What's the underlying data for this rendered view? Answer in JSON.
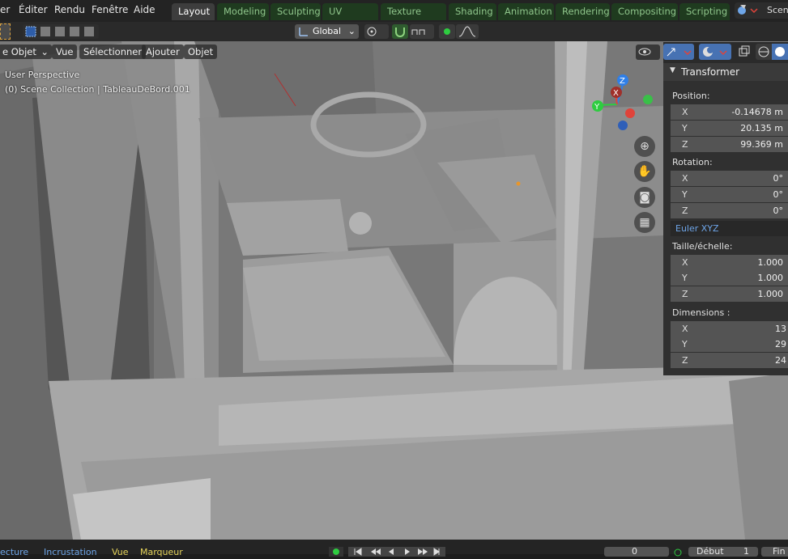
{
  "topbar": {
    "menus": [
      "er",
      "Éditer",
      "Rendu",
      "Fenêtre",
      "Aide"
    ],
    "workspaces": [
      "Layout",
      "Modeling",
      "Sculpting",
      "UV Editing",
      "Texture Paint",
      "Shading",
      "Animation",
      "Rendering",
      "Compositing",
      "Scripting"
    ],
    "active_workspace": "Layout",
    "scene_label": "Scen"
  },
  "toolbar2": {
    "orientation": "Global"
  },
  "viewport_header": {
    "mode": "e Objet",
    "menus": [
      "Vue",
      "Sélectionner",
      "Ajouter",
      "Objet"
    ]
  },
  "viewport": {
    "perspective_label": "User Perspective",
    "collection_label": "(0) Scene Collection | TableauDeBord.001",
    "gizmo": {
      "z": "Z",
      "y": "Y",
      "x": "X"
    }
  },
  "sidebar": {
    "panel_title": "Transformer",
    "position_label": "Position:",
    "position": [
      {
        "axis": "X",
        "value": "-0.14678 m"
      },
      {
        "axis": "Y",
        "value": "20.135 m"
      },
      {
        "axis": "Z",
        "value": "99.369 m"
      }
    ],
    "rotation_label": "Rotation:",
    "rotation": [
      {
        "axis": "X",
        "value": "0°"
      },
      {
        "axis": "Y",
        "value": "0°"
      },
      {
        "axis": "Z",
        "value": "0°"
      }
    ],
    "rotation_mode": "Euler XYZ",
    "scale_label": "Taille/échelle:",
    "scale": [
      {
        "axis": "X",
        "value": "1.000"
      },
      {
        "axis": "Y",
        "value": "1.000"
      },
      {
        "axis": "Z",
        "value": "1.000"
      }
    ],
    "dimensions_label": "Dimensions  :",
    "dimensions": [
      {
        "axis": "X",
        "value": "13"
      },
      {
        "axis": "Y",
        "value": "29"
      },
      {
        "axis": "Z",
        "value": "24"
      }
    ]
  },
  "timeline": {
    "items": [
      "ecture",
      "Incrustation",
      "Vue",
      "Marqueur"
    ],
    "current_frame": "0",
    "start_label": "Début",
    "start_value": "1",
    "end_label": "Fin"
  },
  "colors": {
    "workspace_tab_bg": "#1f3b1f",
    "workspace_tab_text": "#8fc58b",
    "viewport_bg": "#7a7a7a",
    "panel_bg": "#303030",
    "field_bg": "#545454",
    "accent_blue": "#6ea5e8",
    "gizmo_x": "#e0433a",
    "gizmo_y": "#2ecc40",
    "gizmo_z": "#2f7fe8"
  }
}
